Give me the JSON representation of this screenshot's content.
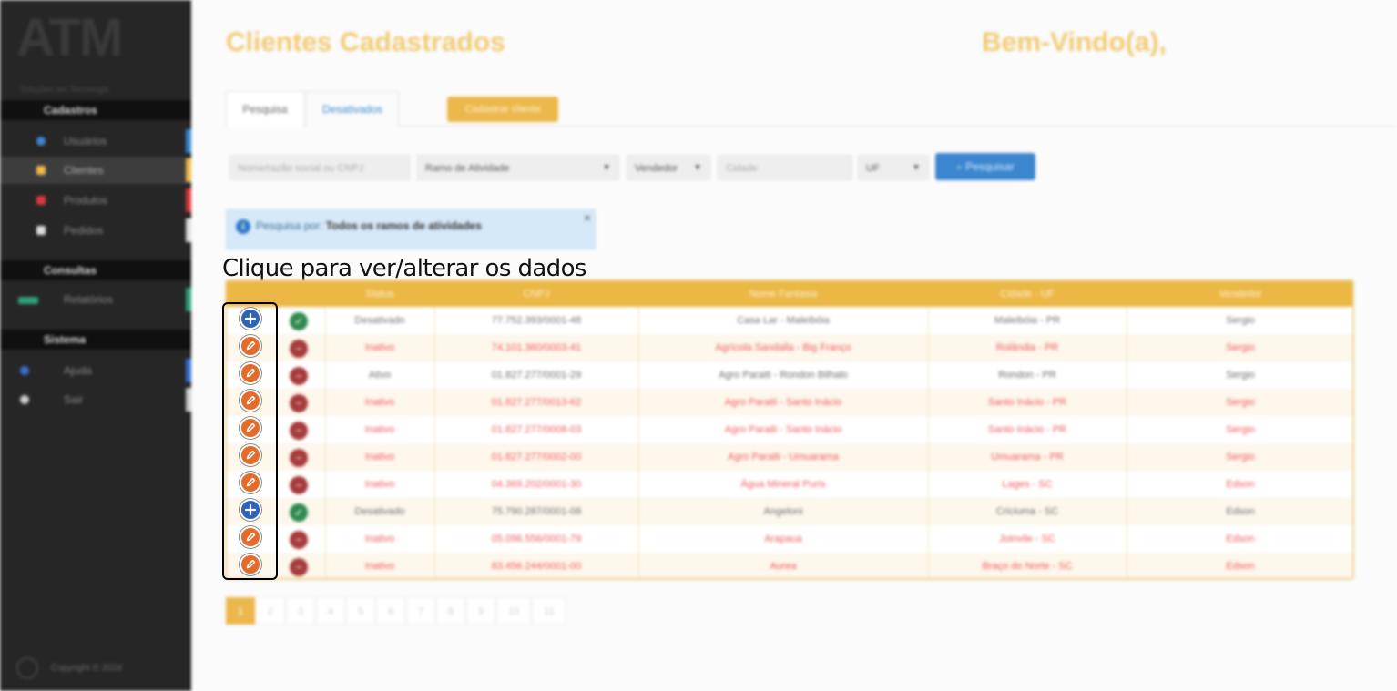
{
  "sidebar": {
    "logo_text": "ATM",
    "logo_sub": "Soluções em Tecnologia",
    "sections": [
      "Cadastros",
      "Consultas",
      "Sistema"
    ],
    "items": [
      {
        "label": "Usuários",
        "icon": "users-icon",
        "color": "#3b86cf"
      },
      {
        "label": "Clientes",
        "icon": "folder-icon",
        "color": "#ecb84b"
      },
      {
        "label": "Produtos",
        "icon": "box-icon",
        "color": "#d93a3a"
      },
      {
        "label": "Pedidos",
        "icon": "clipboard-icon",
        "color": "#dddddd"
      },
      {
        "label": "Relatórios",
        "icon": "chart-icon",
        "color": "#2fa07a"
      },
      {
        "label": "Ajuda",
        "icon": "help-icon",
        "color": "#3b6fd0"
      },
      {
        "label": "Sair",
        "icon": "power-icon",
        "color": "#cccccc"
      }
    ],
    "copyright": "Copyright © 2024"
  },
  "header": {
    "title": "Clientes Cadastrados",
    "welcome": "Bem-Vindo(a),"
  },
  "tabs": [
    "Pesquisa",
    "Desativados"
  ],
  "cadastrar_button": "Cadastrar cliente",
  "filters": {
    "name_placeholder": "Nome/razão social ou CNPJ",
    "ramo_select": "Ramo de Atividade",
    "vendedor_select": "Vendedor",
    "cidade_placeholder": "Cidade",
    "uf_select": "UF",
    "search_button": "Pesquisar"
  },
  "alert": {
    "prefix": "Pesquisa por:",
    "value": "Todos os ramos de atividades",
    "close": "×"
  },
  "hint": "Clique para ver/alterar os dados",
  "table": {
    "columns": [
      "Status",
      "CNPJ",
      "Nome Fantasia",
      "Cidade - UF",
      "Vendedor"
    ],
    "rows": [
      {
        "action": "add",
        "state": "ok",
        "status": "Desativado",
        "cnpj": "77.752.393/0001-48",
        "nome": "Casa Lar - Maleibóia",
        "cidade": "Maleibóia - PR",
        "vendedor": "Sergio"
      },
      {
        "action": "edit",
        "state": "no",
        "status": "Inativo",
        "cnpj": "74.101.360/0003-41",
        "nome": "Agrícola Sandalla - Big Franço",
        "cidade": "Rolândia - PR",
        "vendedor": "Sergio"
      },
      {
        "action": "edit",
        "state": "no",
        "status": "Ativo",
        "cnpj": "01.827.277/0001-29",
        "nome": "Agro Paraiti - Rondon Bilhalo",
        "cidade": "Rondon - PR",
        "vendedor": "Sergio"
      },
      {
        "action": "edit",
        "state": "no",
        "status": "Inativo",
        "cnpj": "01.827.277/0013-62",
        "nome": "Agro Paraiti - Santo Inácio",
        "cidade": "Santo Inácio - PR",
        "vendedor": "Sergio"
      },
      {
        "action": "edit",
        "state": "no",
        "status": "Inativo",
        "cnpj": "01.827.277/0008-03",
        "nome": "Agro Paraiti - Santo Inácio",
        "cidade": "Santo Inácio - PR",
        "vendedor": "Sergio"
      },
      {
        "action": "edit",
        "state": "no",
        "status": "Inativo",
        "cnpj": "01.827.277/0002-00",
        "nome": "Agro Paraiti - Umuarama",
        "cidade": "Umuarama - PR",
        "vendedor": "Sergio"
      },
      {
        "action": "edit",
        "state": "no",
        "status": "Inativo",
        "cnpj": "04.369.202/0001-30",
        "nome": "Água Mineral Puris",
        "cidade": "Lages - SC",
        "vendedor": "Edson"
      },
      {
        "action": "add",
        "state": "ok",
        "status": "Desativado",
        "cnpj": "75.790.287/0001-08",
        "nome": "Angeloni",
        "cidade": "Criciuma - SC",
        "vendedor": "Edson"
      },
      {
        "action": "edit",
        "state": "no",
        "status": "Inativo",
        "cnpj": "05.096.556/0001-79",
        "nome": "Arapaua",
        "cidade": "Joinvile - SC",
        "vendedor": "Edson"
      },
      {
        "action": "edit",
        "state": "no",
        "status": "Inativo",
        "cnpj": "83.456.244/0001-00",
        "nome": "Aurea",
        "cidade": "Braço do Norte - SC",
        "vendedor": "Edson"
      }
    ]
  },
  "pagination": {
    "pages": [
      "1",
      "2",
      "3",
      "4",
      "5",
      "6",
      "7",
      "8",
      "9",
      "10",
      "11"
    ],
    "current": "1"
  }
}
